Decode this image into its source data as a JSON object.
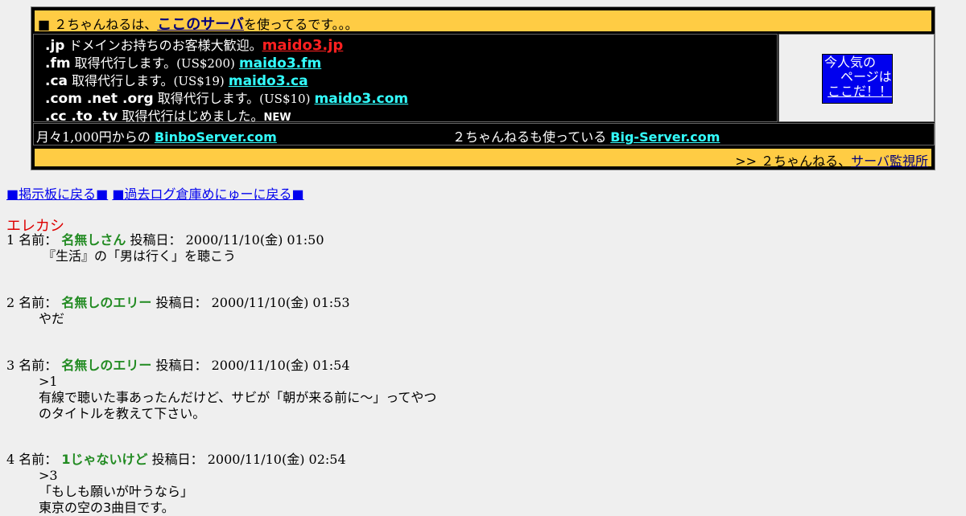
{
  "banner": {
    "top_prefix": "■ ２ちゃんねるは、",
    "top_link": "ここのサーバ",
    "top_suffix": "を使ってるです。。。",
    "domains": [
      {
        "tld": ".jp",
        "desc": "ドメインお持ちのお客様大歓迎。",
        "price": "",
        "link": "maido3.jp"
      },
      {
        "tld": ".fm",
        "desc": "取得代行します。",
        "price": "(US$200)",
        "link": "maido3.fm"
      },
      {
        "tld": ".ca",
        "desc": "取得代行します。",
        "price": "(US$19)",
        "link": "maido3.ca"
      },
      {
        "tld": ".com .net .org",
        "desc": "取得代行します。",
        "price": "(US$10)",
        "link": "maido3.com"
      },
      {
        "tld": ".cc .to .tv",
        "desc": "取得代行はじめました。",
        "price": "",
        "link": ""
      }
    ],
    "new_badge": "NEW",
    "ad_line1": "今人気の",
    "ad_line2": "ページは",
    "ad_link": "ここだ！！",
    "binbo_prefix": "月々1,000円からの",
    "binbo_link": "BinboServer.com",
    "big_prefix": "２ちゃんねるも使っている",
    "big_link": "Big-Server.com",
    "monitor_prefix": ">> ２ちゃんねる、",
    "monitor_link": "サーバ監視所"
  },
  "nav": {
    "back_board": "■掲示板に戻る■",
    "back_archive": "■過去ログ倉庫めにゅーに戻る■"
  },
  "thread": {
    "title": "エレカシ",
    "name_label": "名前：",
    "date_label": "投稿日：",
    "posts": [
      {
        "num": "1",
        "name": "名無しさん",
        "date": "2000/11/10(金) 01:50",
        "lines": [
          "『生活』の「男は行く」を聴こう"
        ]
      },
      {
        "num": "2",
        "name": "名無しのエリー",
        "date": "2000/11/10(金) 01:53",
        "lines": [
          "やだ"
        ]
      },
      {
        "num": "3",
        "name": "名無しのエリー",
        "date": "2000/11/10(金) 01:54",
        "lines": [
          ">1",
          "有線で聴いた事あったんだけど、サビが「朝が来る前に～」ってやつ",
          "のタイトルを教えて下さい。"
        ]
      },
      {
        "num": "4",
        "name": "1じゃないけど",
        "date": "2000/11/10(金) 02:54",
        "lines": [
          ">3",
          "「もしも願いが叶うなら」",
          "東京の空の3曲目です。"
        ]
      }
    ]
  },
  "colors": {
    "banner_yellow": "#ffcc44",
    "link_cyan": "#33ffff",
    "link_red": "#ff2020",
    "name_green": "#228b22",
    "title_red": "#dd0000",
    "ad_blue": "#0000ee"
  }
}
